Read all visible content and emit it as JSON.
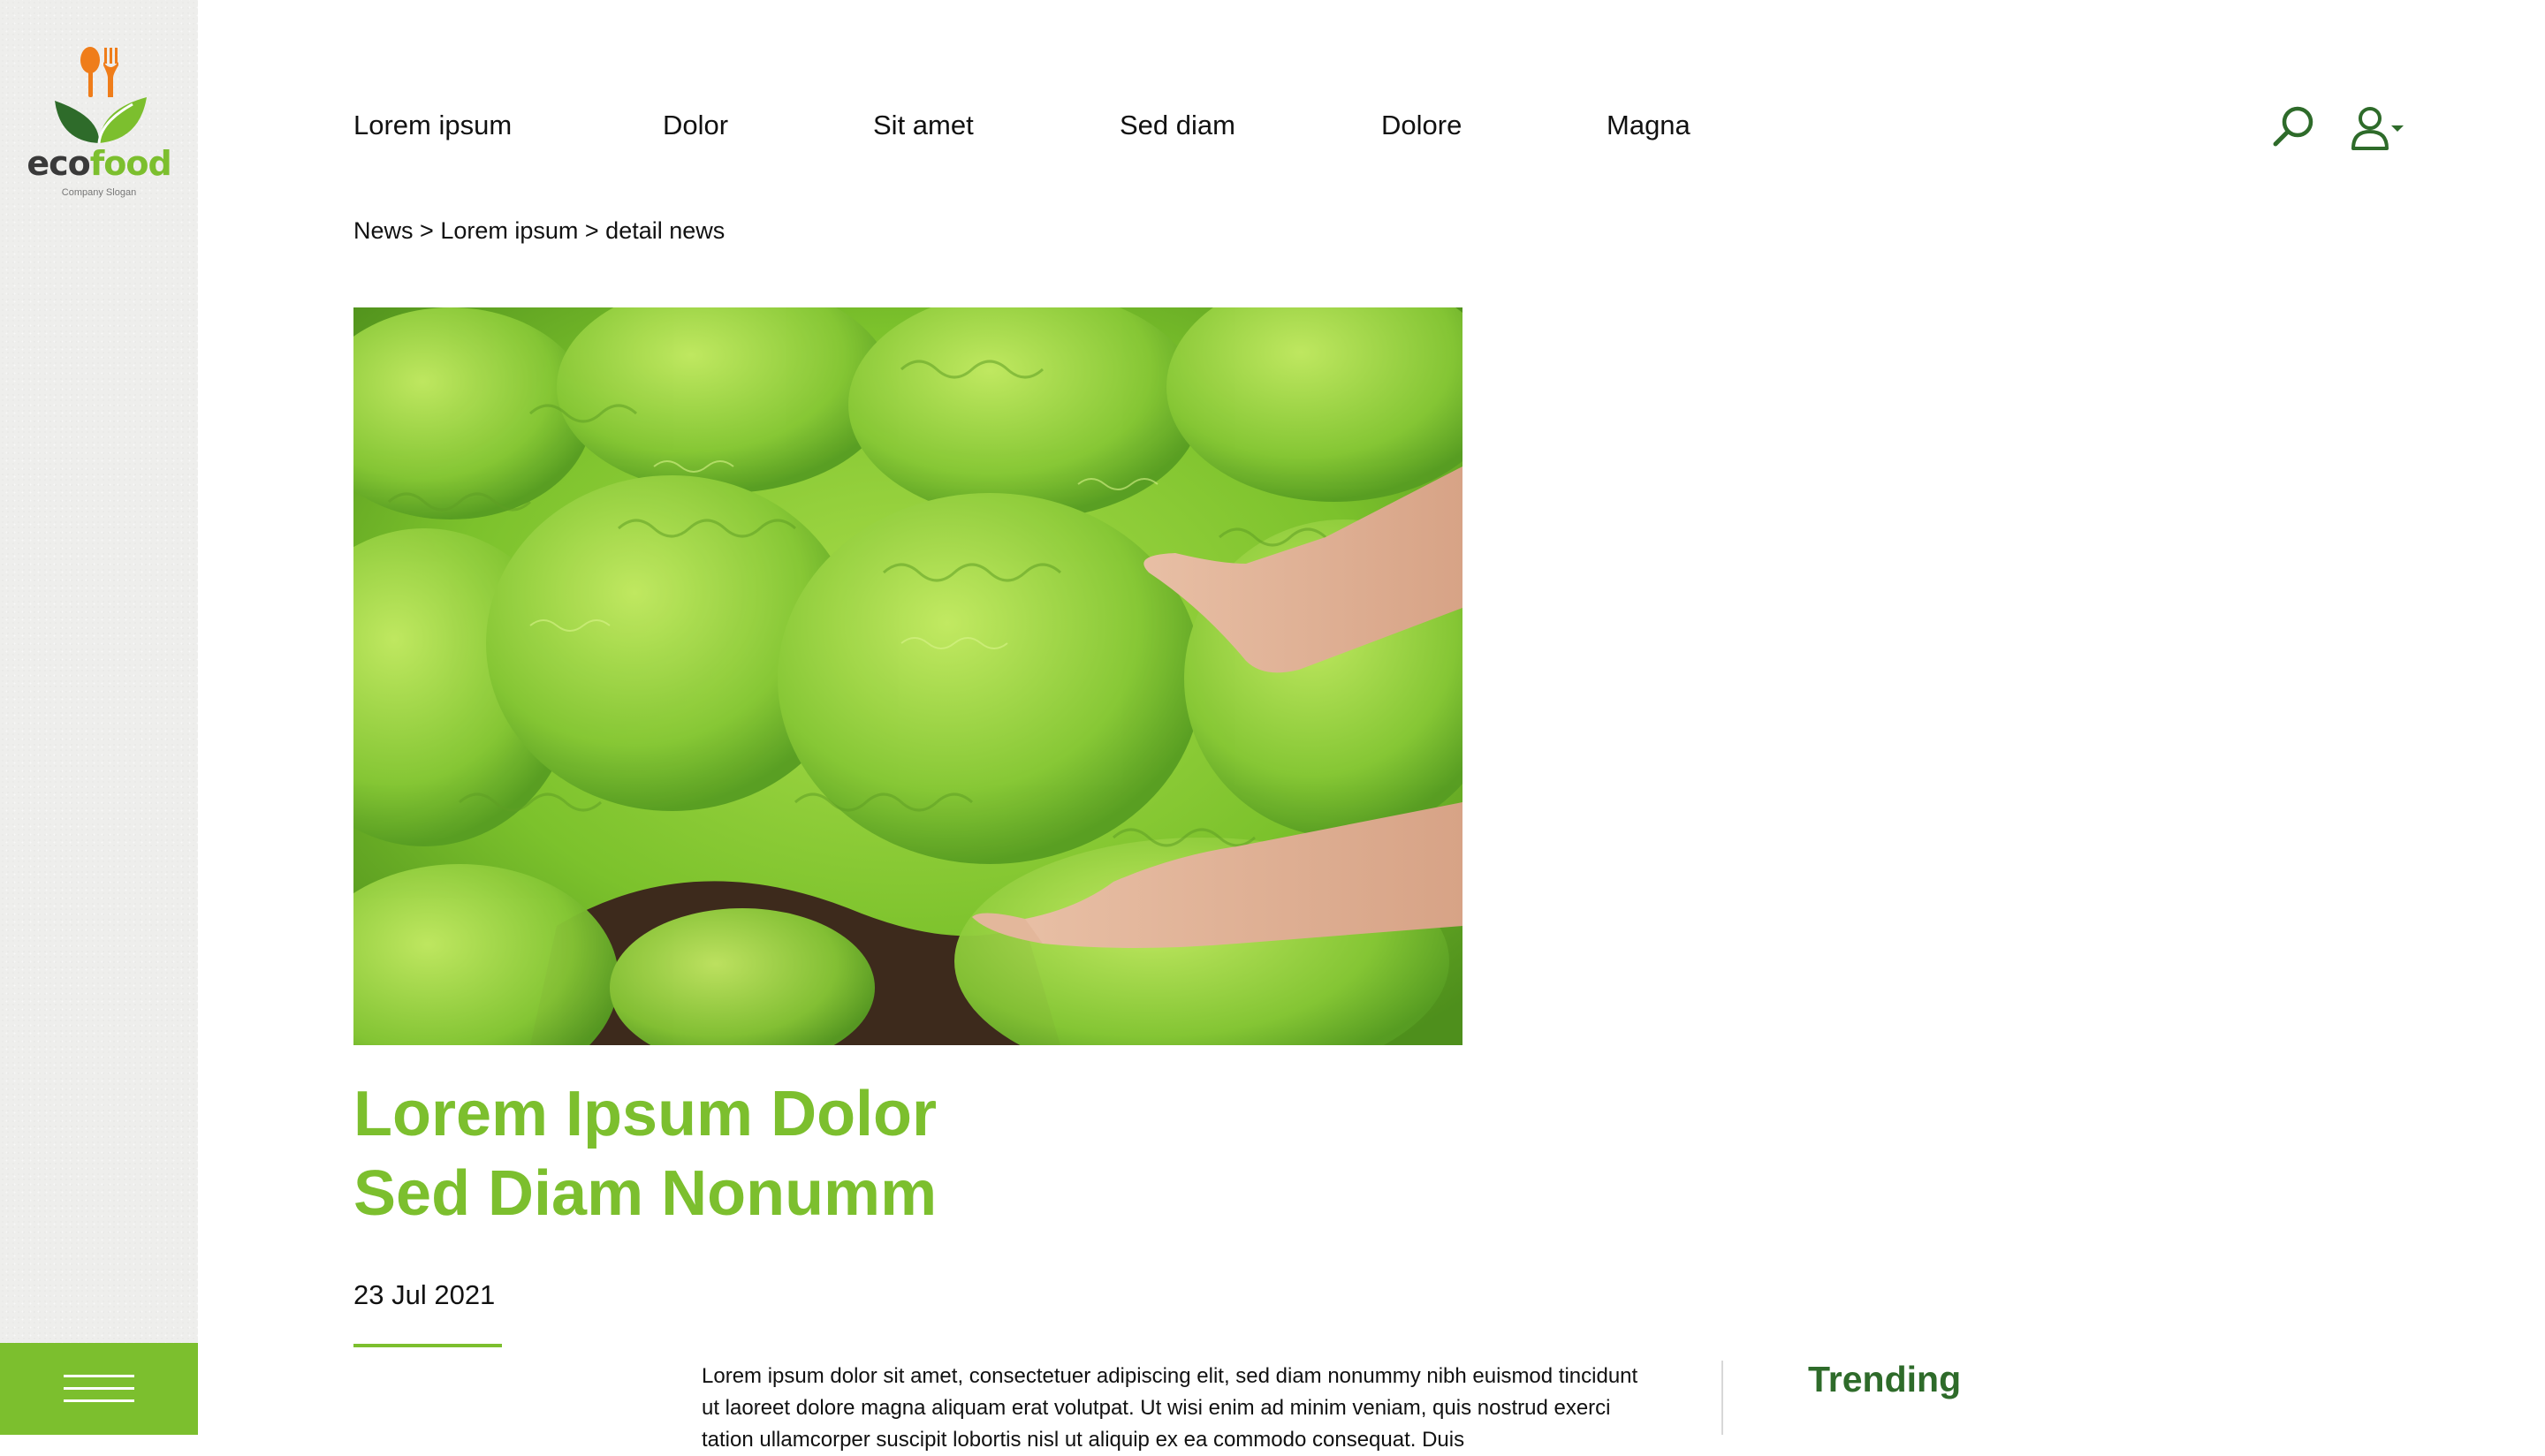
{
  "brand": {
    "name_part1": "eco",
    "name_part2": "food",
    "slogan": "Company Slogan",
    "colors": {
      "green": "#7cbf2e",
      "dark_green": "#2e6b2a",
      "orange": "#ef7d1a"
    }
  },
  "nav": {
    "items": [
      {
        "label": "Lorem ipsum"
      },
      {
        "label": "Dolor"
      },
      {
        "label": "Sit amet"
      },
      {
        "label": "Sed diam"
      },
      {
        "label": "Dolore"
      },
      {
        "label": "Magna"
      }
    ],
    "search_icon": "search-icon",
    "user_icon": "user-dropdown-icon"
  },
  "breadcrumb": {
    "items": [
      "News",
      "Lorem ipsum",
      "detail news"
    ],
    "separator": ">"
  },
  "article": {
    "hero_image": "lettuce-field-with-hands",
    "title_line1": "Lorem Ipsum Dolor",
    "title_line2": "Sed Diam Nonumm",
    "date": "23 Jul 2021",
    "body": "Lorem ipsum dolor sit amet, consectetuer adipiscing elit, sed diam nonummy nibh euismod tincidunt ut laoreet dolore magna aliquam erat volutpat. Ut wisi enim ad minim veniam, quis nostrud exerci tation ullamcorper suscipit lobortis nisl ut aliquip ex ea commodo consequat. Duis"
  },
  "sidebar_right": {
    "trending_label": "Trending"
  },
  "sidebar": {
    "menu_icon": "hamburger-menu-icon"
  }
}
